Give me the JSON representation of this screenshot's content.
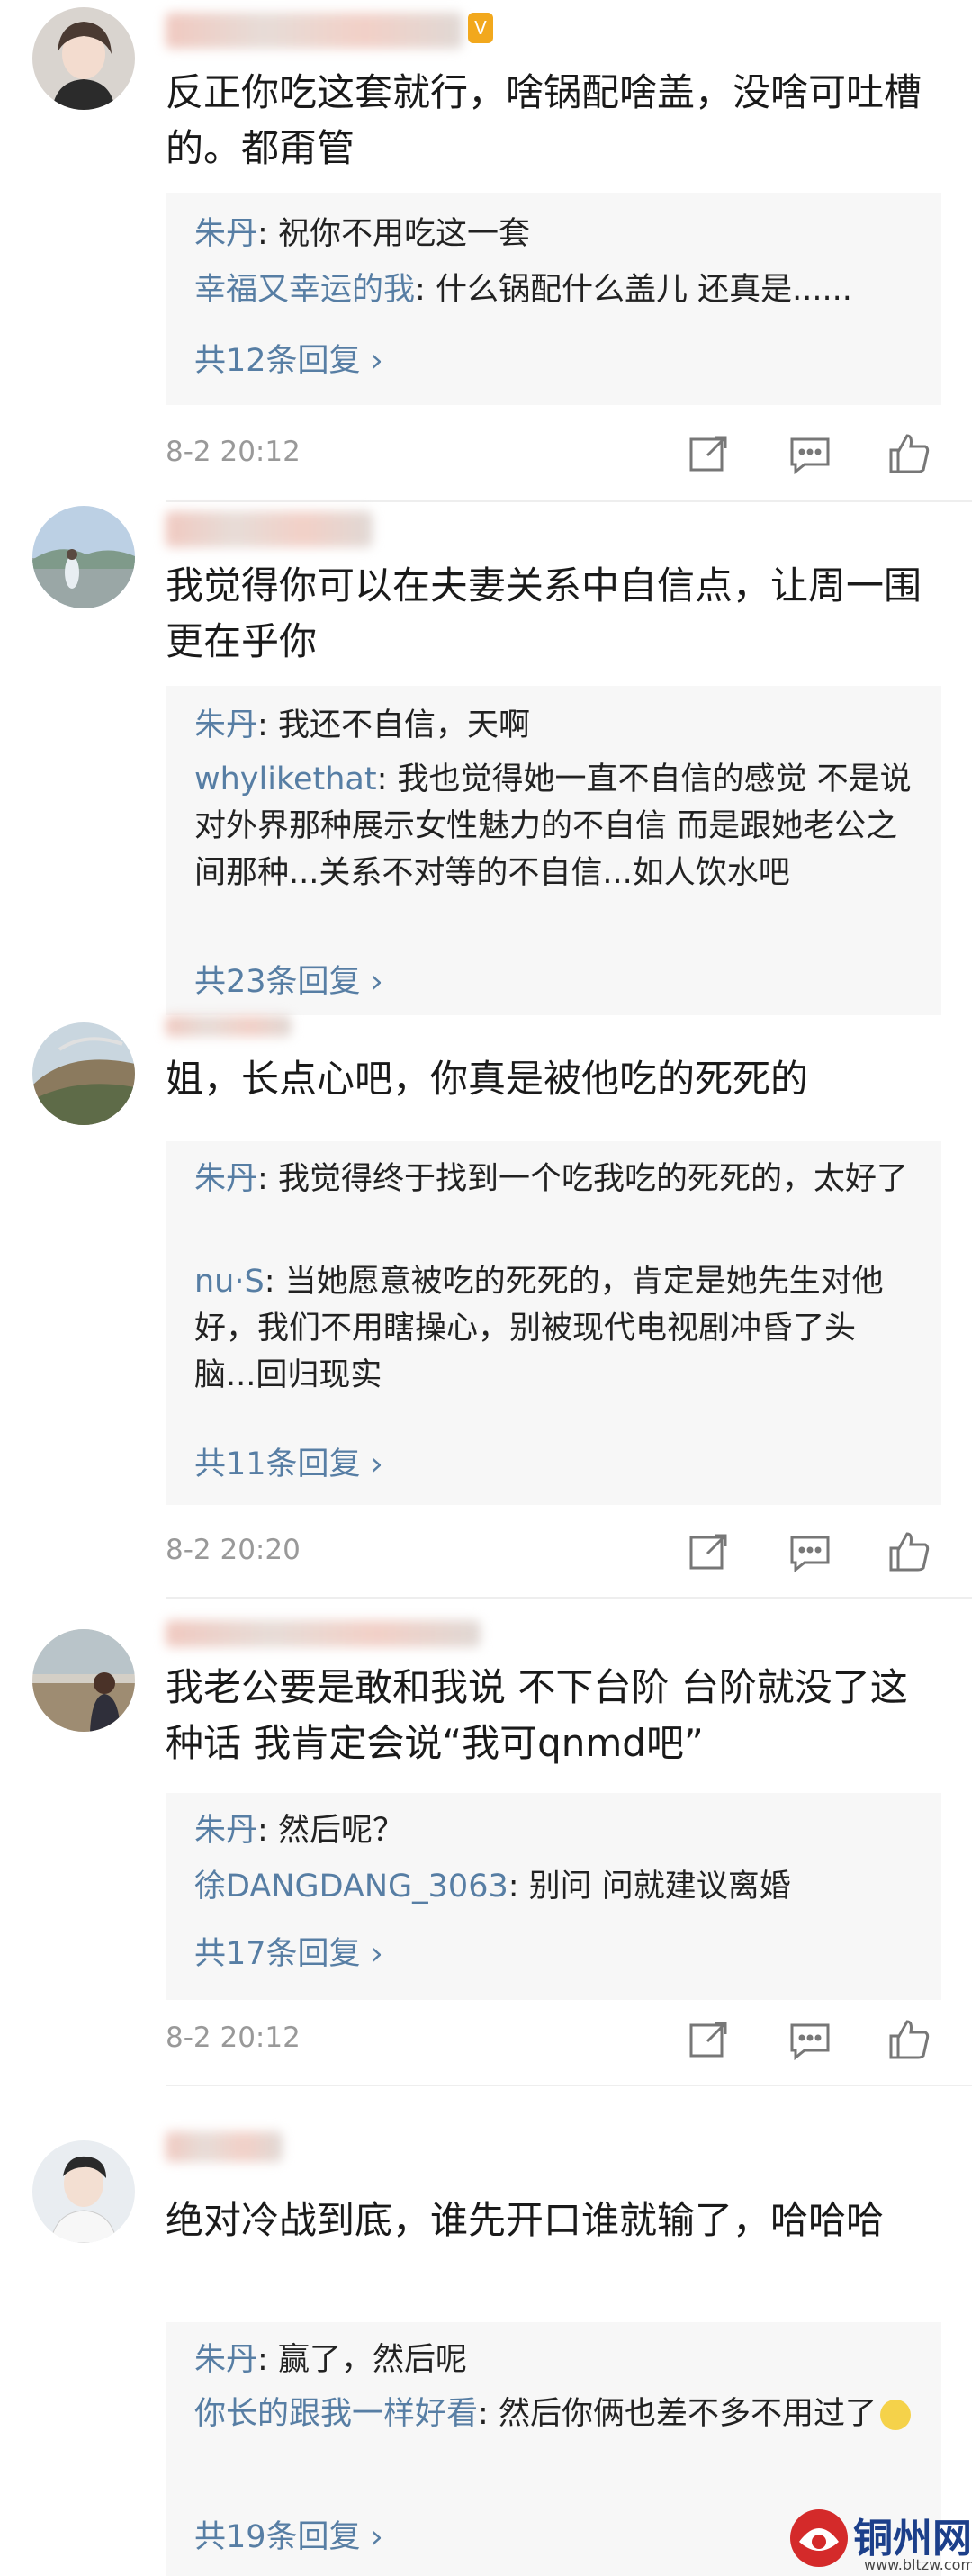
{
  "comments": [
    {
      "body": "反正你吃这套就行，啥锅配啥盖，没啥可吐槽的。都甭管",
      "replies": [
        {
          "name": "朱丹",
          "text": "祝你不用吃这一套"
        },
        {
          "name": "幸福又幸运的我",
          "text": "什么锅配什么盖儿 还真是......"
        }
      ],
      "more": "共12条回复",
      "time": "8-2 20:12"
    },
    {
      "body": "我觉得你可以在夫妻关系中自信点，让周一围更在乎你",
      "replies": [
        {
          "name": "朱丹",
          "text": "我还不自信，天啊"
        },
        {
          "name": "whylikethat",
          "text": "我也觉得她一直不自信的感觉 不是说对外界那种展示女性魅力的不自信 而是跟她老公之间那种...关系不对等的不自信...如人饮水吧"
        }
      ],
      "more": "共23条回复"
    },
    {
      "body": "姐，长点心吧，你真是被他吃的死死的",
      "replies": [
        {
          "name": "朱丹",
          "text": "我觉得终于找到一个吃我吃的死死的，太好了"
        },
        {
          "name": "nu·S",
          "text": "当她愿意被吃的死死的，肯定是她先生对他好，我们不用瞎操心，别被现代电视剧冲昏了头脑...回归现实"
        }
      ],
      "more": "共11条回复",
      "time": "8-2 20:20"
    },
    {
      "body": "我老公要是敢和我说 不下台阶 台阶就没了这种话 我肯定会说“我可qnmd吧”",
      "replies": [
        {
          "name": "朱丹",
          "text": "然后呢？"
        },
        {
          "name": "徐DANGDANG_3063",
          "text": "别问 问就建议离婚"
        }
      ],
      "more": "共17条回复",
      "time": "8-2 20:12"
    },
    {
      "body": "绝对冷战到底，谁先开口谁就输了，哈哈哈",
      "replies": [
        {
          "name": "朱丹",
          "text": "赢了，然后呢"
        },
        {
          "name": "你长的跟我一样好看",
          "text": "然后你俩也差不多不用过了"
        }
      ],
      "more": "共19条回复"
    }
  ],
  "watermark": {
    "name": "铜州网",
    "url": "www.bltzw.com"
  },
  "icons": [
    "share-icon",
    "comment-icon",
    "like-icon"
  ],
  "colors": {
    "link": "#577ea4",
    "reply_bg": "#f7f7f7",
    "meta": "#999999"
  }
}
